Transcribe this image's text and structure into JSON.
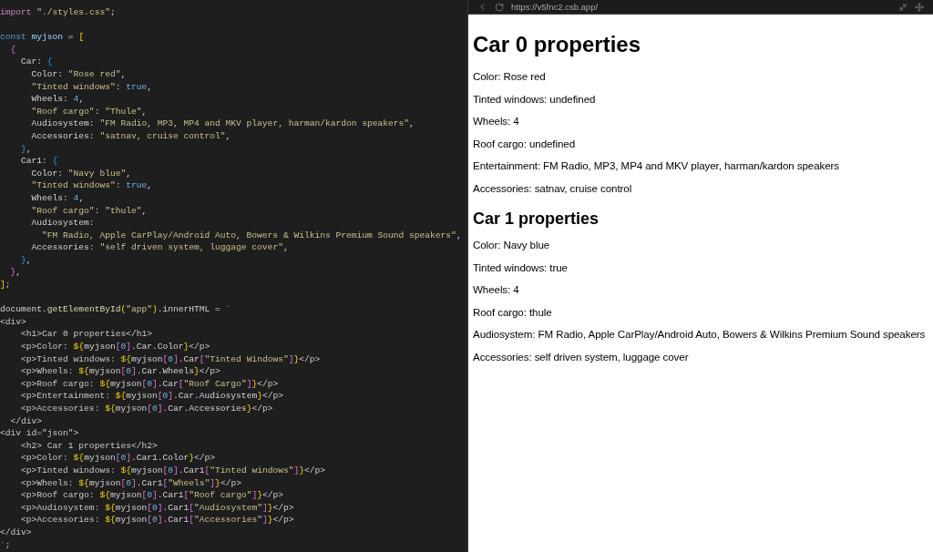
{
  "editor": {
    "lines": [
      {
        "kind": "code",
        "tokens": [
          {
            "kind": "kw",
            "text": "import"
          },
          {
            "kind": "s",
            "text": " \"./styles.css\""
          },
          {
            "kind": "p",
            "text": ";"
          }
        ]
      },
      {
        "kind": "blank"
      },
      {
        "kind": "code",
        "tokens": [
          {
            "kind": "kw2",
            "text": "const"
          },
          {
            "kind": "v",
            "text": " myjson"
          },
          {
            "kind": "p",
            "text": " = "
          },
          {
            "kind": "b1",
            "text": "["
          }
        ]
      },
      {
        "kind": "code",
        "tokens": [
          {
            "kind": "b2",
            "text": "  {"
          }
        ]
      },
      {
        "kind": "code",
        "tokens": [
          {
            "kind": "p",
            "text": "    Car: "
          },
          {
            "kind": "b3",
            "text": "{"
          }
        ]
      },
      {
        "kind": "code",
        "tokens": [
          {
            "kind": "p",
            "text": "      Color: "
          },
          {
            "kind": "s",
            "text": "\"Rose red\""
          },
          {
            "kind": "p",
            "text": ","
          }
        ]
      },
      {
        "kind": "code",
        "tokens": [
          {
            "kind": "s",
            "text": "      \"Tinted windows\""
          },
          {
            "kind": "p",
            "text": ": "
          },
          {
            "kind": "n",
            "text": "true"
          },
          {
            "kind": "p",
            "text": ","
          }
        ]
      },
      {
        "kind": "code",
        "tokens": [
          {
            "kind": "p",
            "text": "      Wheels: "
          },
          {
            "kind": "n",
            "text": "4"
          },
          {
            "kind": "p",
            "text": ","
          }
        ]
      },
      {
        "kind": "code",
        "tokens": [
          {
            "kind": "s",
            "text": "      \"Roof cargo\""
          },
          {
            "kind": "p",
            "text": ": "
          },
          {
            "kind": "s",
            "text": "\"Thule\""
          },
          {
            "kind": "p",
            "text": ","
          }
        ]
      },
      {
        "kind": "code",
        "tokens": [
          {
            "kind": "p",
            "text": "      Audiosystem: "
          },
          {
            "kind": "s",
            "text": "\"FM Radio, MP3, MP4 and MKV player, harman/kardon speakers\""
          },
          {
            "kind": "p",
            "text": ","
          }
        ]
      },
      {
        "kind": "code",
        "tokens": [
          {
            "kind": "p",
            "text": "      Accessories: "
          },
          {
            "kind": "s",
            "text": "\"satnav, cruise control\""
          },
          {
            "kind": "p",
            "text": ","
          }
        ]
      },
      {
        "kind": "code",
        "tokens": [
          {
            "kind": "b3",
            "text": "    }"
          },
          {
            "kind": "p",
            "text": ","
          }
        ]
      },
      {
        "kind": "code",
        "tokens": [
          {
            "kind": "p",
            "text": "    Car1: "
          },
          {
            "kind": "b3",
            "text": "{"
          }
        ]
      },
      {
        "kind": "code",
        "tokens": [
          {
            "kind": "p",
            "text": "      Color: "
          },
          {
            "kind": "s",
            "text": "\"Navy blue\""
          },
          {
            "kind": "p",
            "text": ","
          }
        ]
      },
      {
        "kind": "code",
        "tokens": [
          {
            "kind": "s",
            "text": "      \"Tinted windows\""
          },
          {
            "kind": "p",
            "text": ": "
          },
          {
            "kind": "n",
            "text": "true"
          },
          {
            "kind": "p",
            "text": ","
          }
        ]
      },
      {
        "kind": "code",
        "tokens": [
          {
            "kind": "p",
            "text": "      Wheels: "
          },
          {
            "kind": "n",
            "text": "4"
          },
          {
            "kind": "p",
            "text": ","
          }
        ]
      },
      {
        "kind": "code",
        "tokens": [
          {
            "kind": "s",
            "text": "      \"Roof cargo\""
          },
          {
            "kind": "p",
            "text": ": "
          },
          {
            "kind": "s",
            "text": "\"thule\""
          },
          {
            "kind": "p",
            "text": ","
          }
        ]
      },
      {
        "kind": "code",
        "tokens": [
          {
            "kind": "p",
            "text": "      Audiosystem:"
          }
        ]
      },
      {
        "kind": "code",
        "tokens": [
          {
            "kind": "s",
            "text": "        \"FM Radio, Apple CarPlay/Android Auto, Bowers & Wilkins Premium Sound speakers\""
          },
          {
            "kind": "p",
            "text": ","
          }
        ]
      },
      {
        "kind": "code",
        "tokens": [
          {
            "kind": "p",
            "text": "      Accessories: "
          },
          {
            "kind": "s",
            "text": "\"self driven system, luggage cover\""
          },
          {
            "kind": "p",
            "text": ","
          }
        ]
      },
      {
        "kind": "code",
        "tokens": [
          {
            "kind": "b3",
            "text": "    }"
          },
          {
            "kind": "p",
            "text": ","
          }
        ]
      },
      {
        "kind": "code",
        "tokens": [
          {
            "kind": "b2",
            "text": "  }"
          },
          {
            "kind": "p",
            "text": ","
          }
        ]
      },
      {
        "kind": "code",
        "tokens": [
          {
            "kind": "b1",
            "text": "]"
          },
          {
            "kind": "p",
            "text": ";"
          }
        ]
      },
      {
        "kind": "blank"
      },
      {
        "kind": "code",
        "tokens": [
          {
            "kind": "p",
            "text": "document."
          },
          {
            "kind": "f",
            "text": "getElementById"
          },
          {
            "kind": "b1",
            "text": "("
          },
          {
            "kind": "s",
            "text": "\"app\""
          },
          {
            "kind": "b1",
            "text": ")"
          },
          {
            "kind": "p",
            "text": ".innerHTML = `"
          }
        ]
      },
      {
        "kind": "code",
        "tokens": [
          {
            "kind": "t",
            "text": "<div>"
          }
        ]
      },
      {
        "kind": "code",
        "tokens": [
          {
            "kind": "t",
            "text": "    <h1>Car 0 properties</h1>"
          }
        ]
      },
      {
        "kind": "code",
        "tokens": [
          {
            "kind": "t",
            "text": "    <p>Color: "
          },
          {
            "kind": "b1",
            "text": "${"
          },
          {
            "kind": "p",
            "text": "myjson"
          },
          {
            "kind": "b2",
            "text": "["
          },
          {
            "kind": "n",
            "text": "0"
          },
          {
            "kind": "b2",
            "text": "]"
          },
          {
            "kind": "p",
            "text": ".Car.Color"
          },
          {
            "kind": "b1",
            "text": "}"
          },
          {
            "kind": "t",
            "text": "</p>"
          }
        ]
      },
      {
        "kind": "code",
        "tokens": [
          {
            "kind": "t",
            "text": "    <p>Tinted windows: "
          },
          {
            "kind": "b1",
            "text": "${"
          },
          {
            "kind": "p",
            "text": "myjson"
          },
          {
            "kind": "b2",
            "text": "["
          },
          {
            "kind": "n",
            "text": "0"
          },
          {
            "kind": "b2",
            "text": "]"
          },
          {
            "kind": "p",
            "text": ".Car"
          },
          {
            "kind": "b2",
            "text": "["
          },
          {
            "kind": "s",
            "text": "\"Tinted Windows\""
          },
          {
            "kind": "b2",
            "text": "]"
          },
          {
            "kind": "b1",
            "text": "}"
          },
          {
            "kind": "t",
            "text": "</p>"
          }
        ]
      },
      {
        "kind": "code",
        "tokens": [
          {
            "kind": "t",
            "text": "    <p>Wheels: "
          },
          {
            "kind": "b1",
            "text": "${"
          },
          {
            "kind": "p",
            "text": "myjson"
          },
          {
            "kind": "b2",
            "text": "["
          },
          {
            "kind": "n",
            "text": "0"
          },
          {
            "kind": "b2",
            "text": "]"
          },
          {
            "kind": "p",
            "text": ".Car.Wheels"
          },
          {
            "kind": "b1",
            "text": "}"
          },
          {
            "kind": "t",
            "text": "</p>"
          }
        ]
      },
      {
        "kind": "code",
        "tokens": [
          {
            "kind": "t",
            "text": "    <p>Roof cargo: "
          },
          {
            "kind": "b1",
            "text": "${"
          },
          {
            "kind": "p",
            "text": "myjson"
          },
          {
            "kind": "b2",
            "text": "["
          },
          {
            "kind": "n",
            "text": "0"
          },
          {
            "kind": "b2",
            "text": "]"
          },
          {
            "kind": "p",
            "text": ".Car"
          },
          {
            "kind": "b2",
            "text": "["
          },
          {
            "kind": "s",
            "text": "\"Roof Cargo\""
          },
          {
            "kind": "b2",
            "text": "]"
          },
          {
            "kind": "b1",
            "text": "}"
          },
          {
            "kind": "t",
            "text": "</p>"
          }
        ]
      },
      {
        "kind": "code",
        "tokens": [
          {
            "kind": "t",
            "text": "    <p>Entertainment: "
          },
          {
            "kind": "b1",
            "text": "${"
          },
          {
            "kind": "p",
            "text": "myjson"
          },
          {
            "kind": "b2",
            "text": "["
          },
          {
            "kind": "n",
            "text": "0"
          },
          {
            "kind": "b2",
            "text": "]"
          },
          {
            "kind": "p",
            "text": ".Car.Audiosystem"
          },
          {
            "kind": "b1",
            "text": "}"
          },
          {
            "kind": "t",
            "text": "</p>"
          }
        ]
      },
      {
        "kind": "code",
        "tokens": [
          {
            "kind": "t",
            "text": "    <p>Accessories: "
          },
          {
            "kind": "b1",
            "text": "${"
          },
          {
            "kind": "p",
            "text": "myjson"
          },
          {
            "kind": "b2",
            "text": "["
          },
          {
            "kind": "n",
            "text": "0"
          },
          {
            "kind": "b2",
            "text": "]"
          },
          {
            "kind": "p",
            "text": ".Car.Accessories"
          },
          {
            "kind": "b1",
            "text": "}"
          },
          {
            "kind": "t",
            "text": "</p>"
          }
        ]
      },
      {
        "kind": "code",
        "tokens": [
          {
            "kind": "t",
            "text": "  </div>"
          }
        ]
      },
      {
        "kind": "code",
        "tokens": [
          {
            "kind": "t",
            "text": "<div id=\"json\">"
          }
        ]
      },
      {
        "kind": "code",
        "tokens": [
          {
            "kind": "t",
            "text": "    <h2> Car 1 properties</h2>"
          }
        ]
      },
      {
        "kind": "code",
        "tokens": [
          {
            "kind": "t",
            "text": "    <p>Color: "
          },
          {
            "kind": "b1",
            "text": "${"
          },
          {
            "kind": "p",
            "text": "myjson"
          },
          {
            "kind": "b2",
            "text": "["
          },
          {
            "kind": "n",
            "text": "0"
          },
          {
            "kind": "b2",
            "text": "]"
          },
          {
            "kind": "p",
            "text": ".Car1.Color"
          },
          {
            "kind": "b1",
            "text": "}"
          },
          {
            "kind": "t",
            "text": "</p>"
          }
        ]
      },
      {
        "kind": "code",
        "tokens": [
          {
            "kind": "t",
            "text": "    <p>Tinted windows: "
          },
          {
            "kind": "b1",
            "text": "${"
          },
          {
            "kind": "p",
            "text": "myjson"
          },
          {
            "kind": "b2",
            "text": "["
          },
          {
            "kind": "n",
            "text": "0"
          },
          {
            "kind": "b2",
            "text": "]"
          },
          {
            "kind": "p",
            "text": ".Car1"
          },
          {
            "kind": "b2",
            "text": "["
          },
          {
            "kind": "s",
            "text": "\"Tinted windows\""
          },
          {
            "kind": "b2",
            "text": "]"
          },
          {
            "kind": "b1",
            "text": "}"
          },
          {
            "kind": "t",
            "text": "</p>"
          }
        ]
      },
      {
        "kind": "code",
        "tokens": [
          {
            "kind": "t",
            "text": "    <p>Wheels: "
          },
          {
            "kind": "b1",
            "text": "${"
          },
          {
            "kind": "p",
            "text": "myjson"
          },
          {
            "kind": "b2",
            "text": "["
          },
          {
            "kind": "n",
            "text": "0"
          },
          {
            "kind": "b2",
            "text": "]"
          },
          {
            "kind": "p",
            "text": ".Car1"
          },
          {
            "kind": "b2",
            "text": "["
          },
          {
            "kind": "s",
            "text": "\"Wheels\""
          },
          {
            "kind": "b2",
            "text": "]"
          },
          {
            "kind": "b1",
            "text": "}"
          },
          {
            "kind": "t",
            "text": "</p>"
          }
        ]
      },
      {
        "kind": "code",
        "tokens": [
          {
            "kind": "t",
            "text": "    <p>Roof cargo: "
          },
          {
            "kind": "b1",
            "text": "${"
          },
          {
            "kind": "p",
            "text": "myjson"
          },
          {
            "kind": "b2",
            "text": "["
          },
          {
            "kind": "n",
            "text": "0"
          },
          {
            "kind": "b2",
            "text": "]"
          },
          {
            "kind": "p",
            "text": ".Car1"
          },
          {
            "kind": "b2",
            "text": "["
          },
          {
            "kind": "s",
            "text": "\"Roof cargo\""
          },
          {
            "kind": "b2",
            "text": "]"
          },
          {
            "kind": "b1",
            "text": "}"
          },
          {
            "kind": "t",
            "text": "</p>"
          }
        ]
      },
      {
        "kind": "code",
        "tokens": [
          {
            "kind": "t",
            "text": "    <p>Audiosystem: "
          },
          {
            "kind": "b1",
            "text": "${"
          },
          {
            "kind": "p",
            "text": "myjson"
          },
          {
            "kind": "b2",
            "text": "["
          },
          {
            "kind": "n",
            "text": "0"
          },
          {
            "kind": "b2",
            "text": "]"
          },
          {
            "kind": "p",
            "text": ".Car1"
          },
          {
            "kind": "b2",
            "text": "["
          },
          {
            "kind": "s",
            "text": "\"Audiosystem\""
          },
          {
            "kind": "b2",
            "text": "]"
          },
          {
            "kind": "b1",
            "text": "}"
          },
          {
            "kind": "t",
            "text": "</p>"
          }
        ]
      },
      {
        "kind": "code",
        "tokens": [
          {
            "kind": "t",
            "text": "    <p>Accessories: "
          },
          {
            "kind": "b1",
            "text": "${"
          },
          {
            "kind": "p",
            "text": "myjson"
          },
          {
            "kind": "b2",
            "text": "["
          },
          {
            "kind": "n",
            "text": "0"
          },
          {
            "kind": "b2",
            "text": "]"
          },
          {
            "kind": "p",
            "text": ".Car1"
          },
          {
            "kind": "b2",
            "text": "["
          },
          {
            "kind": "s",
            "text": "\"Accessories\""
          },
          {
            "kind": "b2",
            "text": "]"
          },
          {
            "kind": "b1",
            "text": "}"
          },
          {
            "kind": "t",
            "text": "</p>"
          }
        ]
      },
      {
        "kind": "code",
        "tokens": [
          {
            "kind": "t",
            "text": "</div>"
          }
        ]
      },
      {
        "kind": "code",
        "tokens": [
          {
            "kind": "s",
            "text": "`"
          },
          {
            "kind": "p",
            "text": ";"
          }
        ]
      }
    ]
  },
  "browser": {
    "url": "https://v5fnc2.csb.app/"
  },
  "preview": [
    {
      "kind": "h1",
      "text": "Car 0 properties"
    },
    {
      "kind": "p",
      "text": "Color: Rose red"
    },
    {
      "kind": "p",
      "text": "Tinted windows: undefined"
    },
    {
      "kind": "p",
      "text": "Wheels: 4"
    },
    {
      "kind": "p",
      "text": "Roof cargo: undefined"
    },
    {
      "kind": "p",
      "text": "Entertainment: FM Radio, MP3, MP4 and MKV player, harman/kardon speakers"
    },
    {
      "kind": "p",
      "text": "Accessories: satnav, cruise control"
    },
    {
      "kind": "h2",
      "text": "Car 1 properties"
    },
    {
      "kind": "p",
      "text": "Color: Navy blue"
    },
    {
      "kind": "p",
      "text": "Tinted windows: true"
    },
    {
      "kind": "p",
      "text": "Wheels: 4"
    },
    {
      "kind": "p",
      "text": "Roof cargo: thule"
    },
    {
      "kind": "p",
      "text": "Audiosystem: FM Radio, Apple CarPlay/Android Auto, Bowers & Wilkins Premium Sound speakers"
    },
    {
      "kind": "p",
      "text": "Accessories: self driven system, luggage cover"
    }
  ]
}
